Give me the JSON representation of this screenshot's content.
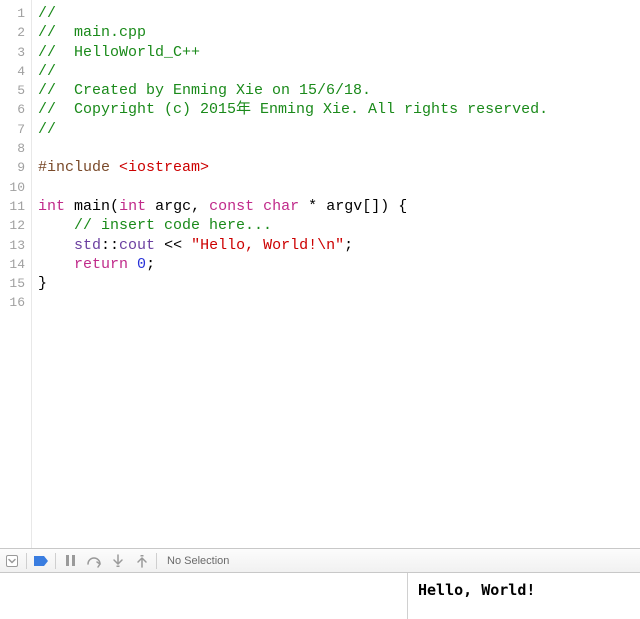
{
  "editor": {
    "start_line": 1,
    "line_count": 16,
    "lines": [
      {
        "type": "comment",
        "t1": "//"
      },
      {
        "type": "comment",
        "t1": "//  main.cpp"
      },
      {
        "type": "comment",
        "t1": "//  HelloWorld_C++"
      },
      {
        "type": "comment",
        "t1": "//"
      },
      {
        "type": "comment",
        "t1": "//  Created by Enming Xie on 15/6/18."
      },
      {
        "type": "comment",
        "t1": "//  Copyright (c) 2015年 Enming Xie. All rights reserved."
      },
      {
        "type": "comment",
        "t1": "//"
      },
      {
        "type": "blank"
      },
      {
        "type": "include",
        "preproc": "#include ",
        "header": "<iostream>"
      },
      {
        "type": "blank"
      },
      {
        "type": "funcsig",
        "kw_int1": "int",
        "sp1": " ",
        "id_main": "main",
        "p1": "(",
        "kw_int2": "int",
        "sp2": " ",
        "id_argc": "argc",
        "p2": ", ",
        "kw_const": "const",
        "sp3": " ",
        "kw_char": "char",
        "p3": " * ",
        "id_argv": "argv",
        "p4": "[]) {"
      },
      {
        "type": "body_comment",
        "indent": "    ",
        "t1": "// insert code here..."
      },
      {
        "type": "cout",
        "indent": "    ",
        "ns": "std",
        "cc": "::",
        "id_cout": "cout",
        "sp1": " ",
        "op": "<<",
        "sp2": " ",
        "str": "\"Hello, World!\\n\"",
        "semi": ";"
      },
      {
        "type": "return",
        "indent": "    ",
        "kw_return": "return",
        "sp1": " ",
        "num": "0",
        "semi": ";"
      },
      {
        "type": "brace",
        "t1": "}"
      },
      {
        "type": "blank"
      }
    ]
  },
  "toolbar": {
    "selection_label": "No Selection"
  },
  "console": {
    "output": "Hello, World!"
  }
}
